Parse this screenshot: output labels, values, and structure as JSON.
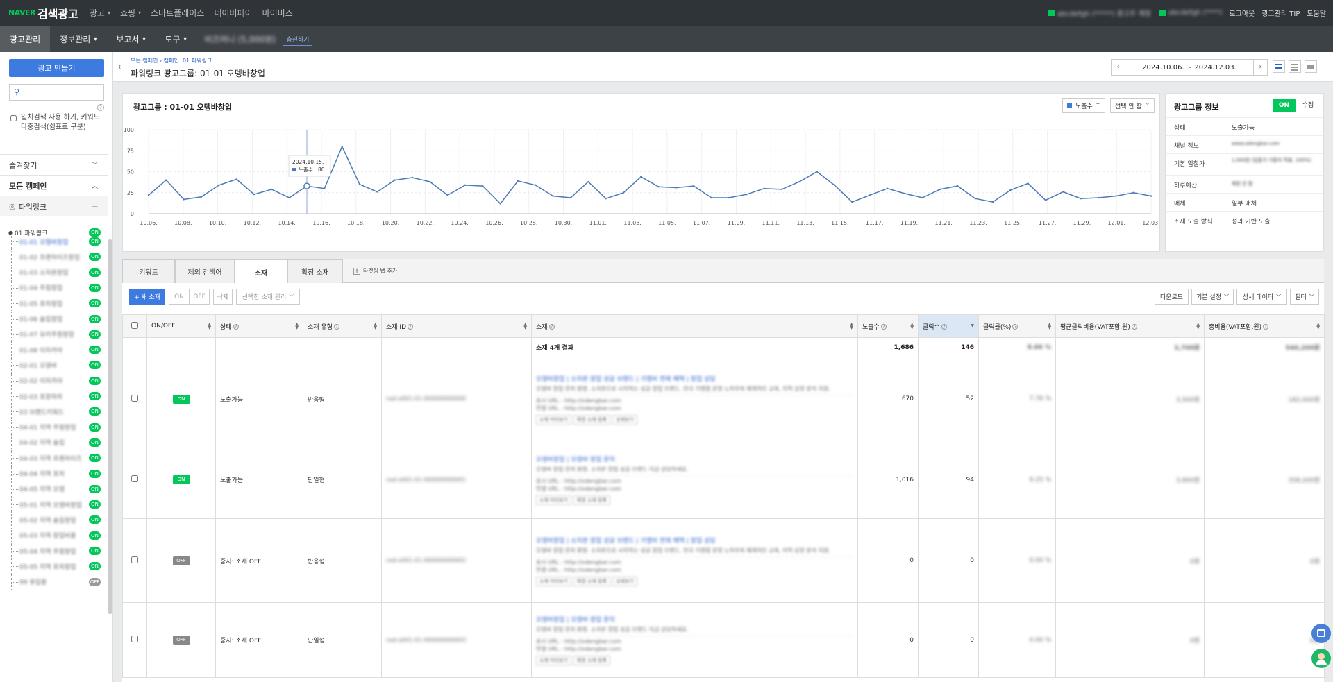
{
  "topbar": {
    "brand": "NAVER",
    "title": "검색광고",
    "nav": [
      {
        "label": "광고",
        "dd": true
      },
      {
        "label": "쇼핑",
        "dd": true
      },
      {
        "label": "스마트플레이스",
        "dd": false
      },
      {
        "label": "네이버페이",
        "dd": false
      },
      {
        "label": "마이비즈",
        "dd": false
      }
    ],
    "account1": "abcdefgh (*****) 광고주 계정",
    "account2": "abcdefgh (****)",
    "logout": "로그아웃",
    "tip": "광고관리 TIP",
    "help": "도움말"
  },
  "secbar": {
    "items": [
      {
        "label": "광고관리",
        "dd": false
      },
      {
        "label": "정보관리",
        "dd": true
      },
      {
        "label": "보고서",
        "dd": true
      },
      {
        "label": "도구",
        "dd": true
      }
    ],
    "biz_money": "비즈머니 (5,000원)",
    "charge": "충전하기"
  },
  "sidebar": {
    "create_button": "광고 만들기",
    "search_placeholder": "",
    "exact_match": "일치검색 사용 하기, 키워드 다중검색(쉼표로 구분)",
    "favorites": "즐겨찾기",
    "all_campaigns": "모든 캠페인",
    "powerlink": "파워링크",
    "campaign": "01 파워링크",
    "campaign_status": "ON",
    "groups": [
      {
        "label": "01-01 오텡바창업",
        "status": "ON"
      },
      {
        "label": "01-02 프랜차이즈창업",
        "status": "ON"
      },
      {
        "label": "01-03 소자본창업",
        "status": "ON"
      },
      {
        "label": "01-04 주점창업",
        "status": "ON"
      },
      {
        "label": "01-05 포차창업",
        "status": "ON"
      },
      {
        "label": "01-06 술집창업",
        "status": "ON"
      },
      {
        "label": "01-07 요리주점창업",
        "status": "ON"
      },
      {
        "label": "01-08 이자카야",
        "status": "ON"
      },
      {
        "label": "02-01 오뎅바",
        "status": "ON"
      },
      {
        "label": "02-02 이자카야",
        "status": "ON"
      },
      {
        "label": "02-03 포장마차",
        "status": "ON"
      },
      {
        "label": "03 브랜드키워드",
        "status": "ON"
      },
      {
        "label": "04-01 지역 주점창업",
        "status": "ON"
      },
      {
        "label": "04-02 지역 술집",
        "status": "ON"
      },
      {
        "label": "04-03 지역 프랜차이즈",
        "status": "ON"
      },
      {
        "label": "04-04 지역 포차",
        "status": "ON"
      },
      {
        "label": "04-05 지역 오뎅",
        "status": "ON"
      },
      {
        "label": "05-01 지역 오뎅바창업",
        "status": "ON"
      },
      {
        "label": "05-02 지역 술집창업",
        "status": "ON"
      },
      {
        "label": "05-03 지역 창업비용",
        "status": "ON"
      },
      {
        "label": "05-04 지역 주점창업",
        "status": "ON"
      },
      {
        "label": "05-05 지역 포차창업",
        "status": "ON"
      },
      {
        "label": "99 유입용",
        "status": "OFF"
      }
    ]
  },
  "header": {
    "breadcrumb": "모든 캠페인 › 캠페인: 01 파워링크",
    "title": "파워링크 광고그룹: 01-01 오뎅바창업",
    "date_range": "2024.10.06. ~ 2024.12.03."
  },
  "chart_panel": {
    "title": "광고그룹 : 01-01 오뎅바창업",
    "metric_select": "노출수",
    "compare_select": "선택 안 함",
    "tooltip_date": "2024.10.15.",
    "tooltip_label": "노출수 : 80"
  },
  "chart_data": {
    "type": "line",
    "series": [
      {
        "name": "노출수",
        "values": [
          22,
          40,
          17,
          20,
          34,
          41,
          23,
          29,
          19,
          33,
          30,
          80,
          35,
          26,
          40,
          43,
          38,
          22,
          34,
          33,
          12,
          39,
          34,
          21,
          19,
          38,
          18,
          25,
          44,
          32,
          31,
          33,
          19,
          19,
          23,
          30,
          29,
          38,
          50,
          34,
          14,
          22,
          30,
          24,
          19,
          29,
          33,
          18,
          14,
          28,
          36,
          16,
          26,
          18,
          19,
          21,
          25,
          21
        ]
      }
    ],
    "x_ticks": [
      "10.06.",
      "10.08.",
      "10.10.",
      "10.12.",
      "10.14.",
      "10.16.",
      "10.18.",
      "10.20.",
      "10.22.",
      "10.24.",
      "10.26.",
      "10.28.",
      "10.30.",
      "11.01.",
      "11.03.",
      "11.05.",
      "11.07.",
      "11.09.",
      "11.11.",
      "11.13.",
      "11.15.",
      "11.17.",
      "11.19.",
      "11.21.",
      "11.23.",
      "11.25.",
      "11.27.",
      "11.29.",
      "12.01.",
      "12.03."
    ],
    "y_ticks": [
      0,
      25,
      50,
      75,
      100
    ],
    "ylim": [
      0,
      100
    ],
    "grid": true,
    "color": "#4a7ab7"
  },
  "info_panel": {
    "title": "광고그룹 정보",
    "on_label": "ON",
    "edit_label": "수정",
    "rows": [
      {
        "key": "상태",
        "value": "노출가능",
        "blur": false,
        "link": false
      },
      {
        "key": "채널 정보",
        "value": "www.odengbar.com",
        "blur": true,
        "link": false
      },
      {
        "key": "기본 입찰가",
        "value": "1,000원 (입찰가 가중치 적용, 100%)",
        "blur": true,
        "link": true
      },
      {
        "key": "하루예산",
        "value": "제한 안 함",
        "blur": true,
        "link": true
      },
      {
        "key": "매체",
        "value": "일부 매체",
        "blur": false,
        "link": true
      },
      {
        "key": "소재 노출 방식",
        "value": "성과 기반 노출",
        "blur": false,
        "link": true
      }
    ]
  },
  "tabs": {
    "items": [
      "키워드",
      "제외 검색어",
      "소재",
      "확장 소재"
    ],
    "active": 2,
    "add": "타겟팅 탭 추가"
  },
  "toolbar": {
    "new": "+ 새 소재",
    "on": "ON",
    "off": "OFF",
    "delete": "삭제",
    "manage": "선택한 소재 관리",
    "download": "다운로드",
    "setting": "기본 설정",
    "detail": "상세 데이터",
    "filter": "필터"
  },
  "table": {
    "headers": [
      "ON/OFF",
      "상태",
      "소재 유형",
      "소재 ID",
      "소재",
      "노출수",
      "클릭수",
      "클릭률(%)",
      "평균클릭비용(VAT포함,원)",
      "총비용(VAT포함,원)"
    ],
    "summary": {
      "label": "소재 4개 결과",
      "impressions": "1,686",
      "clicks": "146",
      "ctr": "8.66 %",
      "cpc": "3,700원",
      "cost": "540,200원"
    },
    "rows": [
      {
        "onoff": "ON",
        "status": "노출가능",
        "type": "반응형",
        "id": "nad-a001-01-000000000000",
        "title": "오뎅바창업 | 소자본 창업 성공 브랜드 | 가맹비 면제 혜택 | 창업 상담",
        "desc": "오뎅바 창업 문의 환영. 소자본으로 시작하는 성공 창업 브랜드. 전국 가맹점 운영 노하우와 체계적인 교육, 지역 상권 분석 지원.",
        "url1": "표시 URL : http://odengbar.com",
        "url2": "연결 URL : http://odengbar.com",
        "btns": [
          "소재 미리보기",
          "확장 소재 등록",
          "상세보기"
        ],
        "impressions": "670",
        "clicks": "52",
        "ctr": "7.76 %",
        "cpc": "3,500원",
        "cost": "182,000원"
      },
      {
        "onoff": "ON",
        "status": "노출가능",
        "type": "단일형",
        "id": "nad-a001-01-000000000001",
        "title": "오뎅바창업 | 오뎅바 창업 문의",
        "desc": "오뎅바 창업 문의 환영. 소자본 창업 성공 브랜드 지금 상담하세요.",
        "url1": "표시 URL : http://odengbar.com",
        "url2": "연결 URL : http://odengbar.com",
        "btns": [
          "소재 미리보기",
          "확장 소재 등록"
        ],
        "impressions": "1,016",
        "clicks": "94",
        "ctr": "9.25 %",
        "cpc": "3,800원",
        "cost": "358,200원"
      },
      {
        "onoff": "OFF",
        "status": "중지: 소재 OFF",
        "type": "반응형",
        "id": "nad-a001-01-000000000002",
        "title": "오뎅바창업 | 소자본 창업 성공 브랜드 | 가맹비 면제 혜택 | 창업 상담",
        "desc": "오뎅바 창업 문의 환영. 소자본으로 시작하는 성공 창업 브랜드. 전국 가맹점 운영 노하우와 체계적인 교육, 지역 상권 분석 지원.",
        "url1": "표시 URL : http://odengbar.com",
        "url2": "연결 URL : http://odengbar.com",
        "btns": [
          "소재 미리보기",
          "확장 소재 등록",
          "상세보기"
        ],
        "impressions": "0",
        "clicks": "0",
        "ctr": "0.00 %",
        "cpc": "0원",
        "cost": "0원"
      },
      {
        "onoff": "OFF",
        "status": "중지: 소재 OFF",
        "type": "단일형",
        "id": "nad-a001-01-000000000003",
        "title": "오뎅바창업 | 오뎅바 창업 문의",
        "desc": "오뎅바 창업 문의 환영. 소자본 창업 성공 브랜드 지금 상담하세요.",
        "url1": "표시 URL : http://odengbar.com",
        "url2": "연결 URL : http://odengbar.com",
        "btns": [
          "소재 미리보기",
          "확장 소재 등록"
        ],
        "impressions": "0",
        "clicks": "0",
        "ctr": "0.00 %",
        "cpc": "0원",
        "cost": "0원"
      }
    ]
  },
  "colors": {
    "accent": "#3e7be0",
    "on": "#03c75a",
    "topbar": "#2f3439",
    "link": "#2f63c9"
  }
}
